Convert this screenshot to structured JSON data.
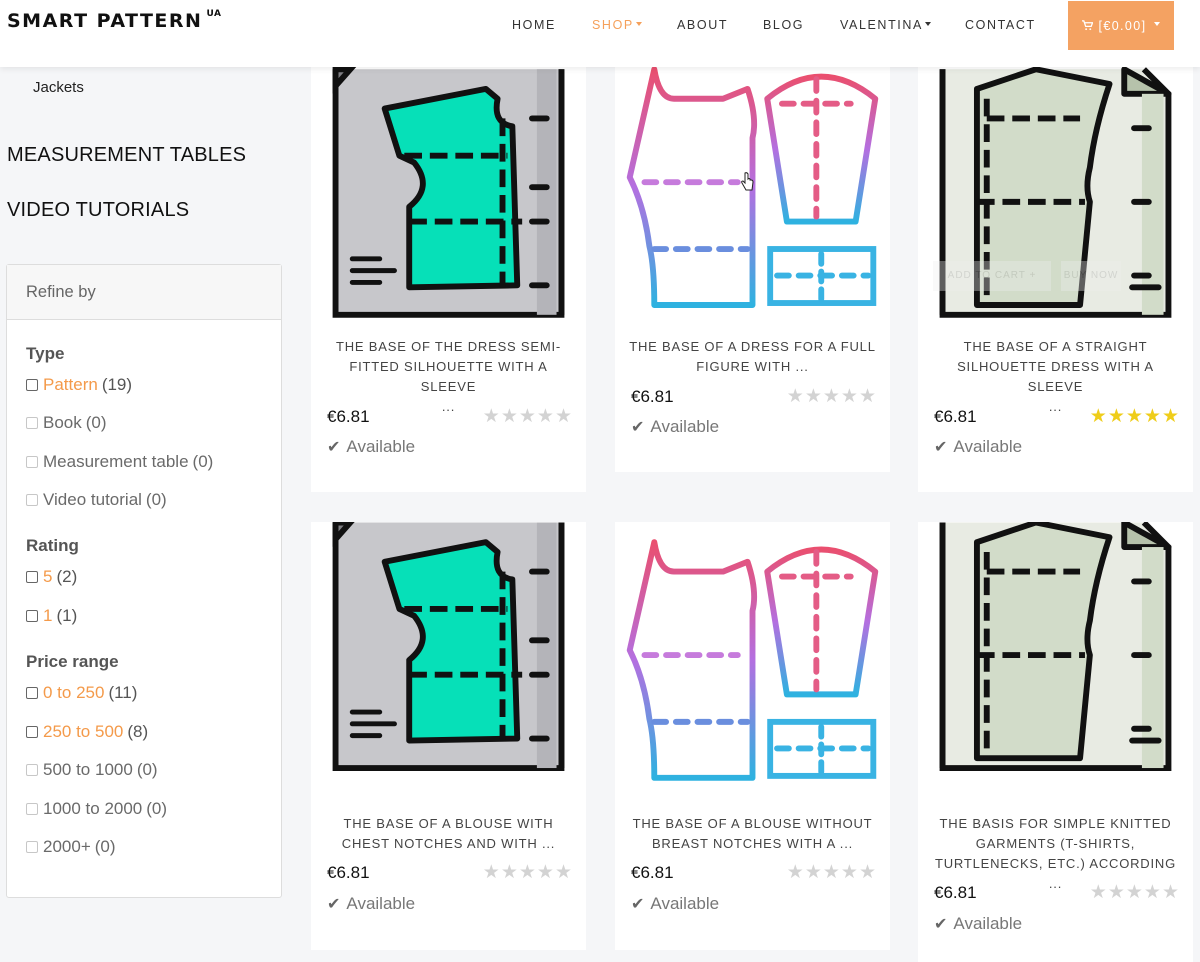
{
  "header": {
    "brand": "SMART PATTERN",
    "brand_sup": "UA",
    "nav": [
      {
        "label": "HOME",
        "active": false,
        "dropdown": false
      },
      {
        "label": "SHOP",
        "active": true,
        "dropdown": true
      },
      {
        "label": "ABOUT",
        "active": false,
        "dropdown": false
      },
      {
        "label": "BLOG",
        "active": false,
        "dropdown": false
      },
      {
        "label": "VALENTINA",
        "active": false,
        "dropdown": true
      },
      {
        "label": "CONTACT",
        "active": false,
        "dropdown": false
      }
    ],
    "cart_label": "[€0.00]"
  },
  "sidebar": {
    "subcategory": "Jackets",
    "categories": [
      "MEASUREMENT TABLES",
      "VIDEO TUTORIALS"
    ],
    "refine_title": "Refine by",
    "groups": [
      {
        "title": "Type",
        "options": [
          {
            "label": "Pattern",
            "count": "(19)",
            "enabled": true
          },
          {
            "label": "Book",
            "count": "(0)",
            "enabled": false
          },
          {
            "label": "Measurement table",
            "count": "(0)",
            "enabled": false
          },
          {
            "label": "Video tutorial",
            "count": "(0)",
            "enabled": false
          }
        ]
      },
      {
        "title": "Rating",
        "options": [
          {
            "label": "5",
            "count": "(2)",
            "enabled": true
          },
          {
            "label": "1",
            "count": "(1)",
            "enabled": true
          }
        ]
      },
      {
        "title": "Price range",
        "options": [
          {
            "label": "0 to 250",
            "count": "(11)",
            "enabled": true
          },
          {
            "label": "250 to 500",
            "count": "(8)",
            "enabled": true
          },
          {
            "label": "500 to 1000",
            "count": "(0)",
            "enabled": false
          },
          {
            "label": "1000 to 2000",
            "count": "(0)",
            "enabled": false
          },
          {
            "label": "2000+",
            "count": "(0)",
            "enabled": false
          }
        ]
      }
    ]
  },
  "products": [
    {
      "title_lines": [
        "THE BASE OF THE DRESS SEMI-",
        "FITTED SILHOUETTE WITH A SLEEVE",
        "..."
      ],
      "price": "€6.81",
      "rating": 0,
      "availability": "Available",
      "image": "green-bodice-pattern-icon"
    },
    {
      "title_lines": [
        "THE BASE OF A DRESS FOR A FULL",
        "FIGURE WITH ..."
      ],
      "price": "€6.81",
      "rating": 0,
      "availability": "Available",
      "image": "gradient-dress-pattern-icon"
    },
    {
      "title_lines": [
        "THE BASE OF A STRAIGHT",
        "SILHOUETTE DRESS WITH A SLEEVE",
        "..."
      ],
      "price": "€6.81",
      "rating": 5,
      "availability": "Available",
      "image": "sage-dress-pattern-icon"
    },
    {
      "title_lines": [
        "THE BASE OF A BLOUSE WITH",
        "CHEST NOTCHES AND WITH ..."
      ],
      "price": "€6.81",
      "rating": 0,
      "availability": "Available",
      "image": "green-bodice-pattern-icon"
    },
    {
      "title_lines": [
        "THE BASE OF A BLOUSE WITHOUT",
        "BREAST NOTCHES WITH A ..."
      ],
      "price": "€6.81",
      "rating": 0,
      "availability": "Available",
      "image": "gradient-dress-pattern-icon"
    },
    {
      "title_lines": [
        "THE BASIS FOR SIMPLE KNITTED",
        "GARMENTS (T-SHIRTS,",
        "TURTLENECKS, ETC.) ACCORDING ..."
      ],
      "price": "€6.81",
      "rating": 0,
      "availability": "Available",
      "image": "sage-dress-pattern-icon"
    }
  ],
  "hover_overlay": {
    "add_to_cart": "ADD TO CART +",
    "buy_now": "BUY NOW"
  },
  "colors": {
    "accent": "#f4a262",
    "star_on": "#efcd1a",
    "star_off": "#d3d3d3",
    "teal": "#06e0b8",
    "sage": "#d2dcc9"
  }
}
